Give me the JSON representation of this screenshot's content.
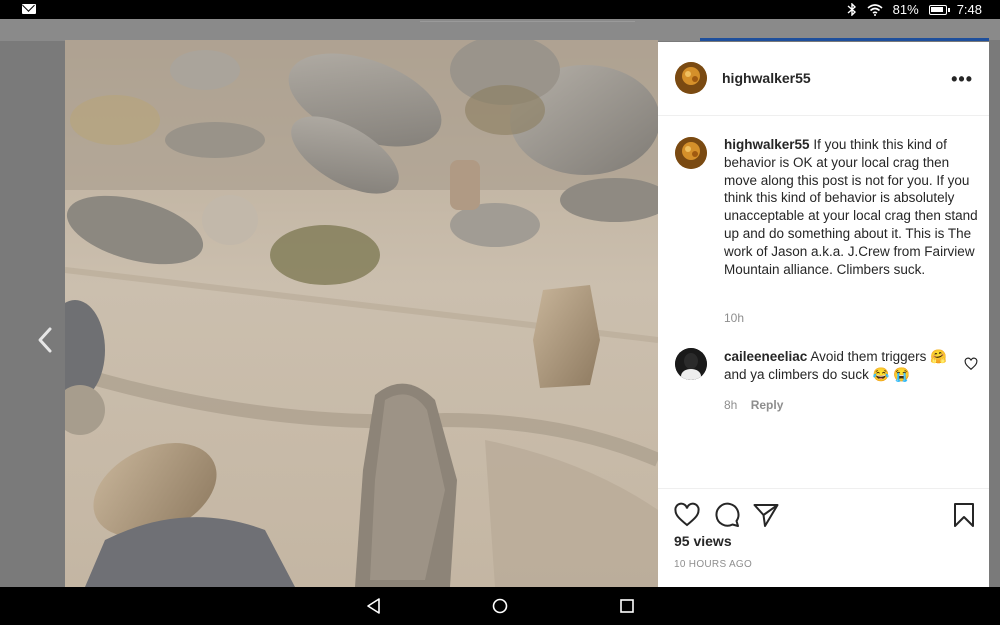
{
  "status_bar": {
    "battery_percent": "81%",
    "time": "7:48",
    "icons": [
      "mail-icon",
      "bluetooth-icon",
      "wifi-icon",
      "battery-icon"
    ]
  },
  "post": {
    "username": "highwalker55",
    "more_icon": "more-options-icon",
    "caption_username": "highwalker55",
    "caption_text": "If you think this kind of behavior is OK at your local crag then move along this post is not for you. If you think this kind of behavior is absolutely unacceptable at your local crag then stand up and do something about it. This is The work of Jason a.k.a. J.Crew from Fairview Mountain alliance. Climbers suck.",
    "caption_time": "10h",
    "comments": [
      {
        "username": "caileeneeliac",
        "text": "Avoid them triggers 🤗 and ya climbers do suck 😂 😭",
        "time": "8h",
        "reply_label": "Reply"
      }
    ],
    "views": "95 views",
    "posted_ago": "10 HOURS AGO"
  },
  "colors": {
    "status_bar_bg": "#000000",
    "panel_bg": "#ffffff",
    "text_primary": "#262626",
    "text_secondary": "#8e8e8e",
    "accent_blue": "#1e4f9c"
  }
}
